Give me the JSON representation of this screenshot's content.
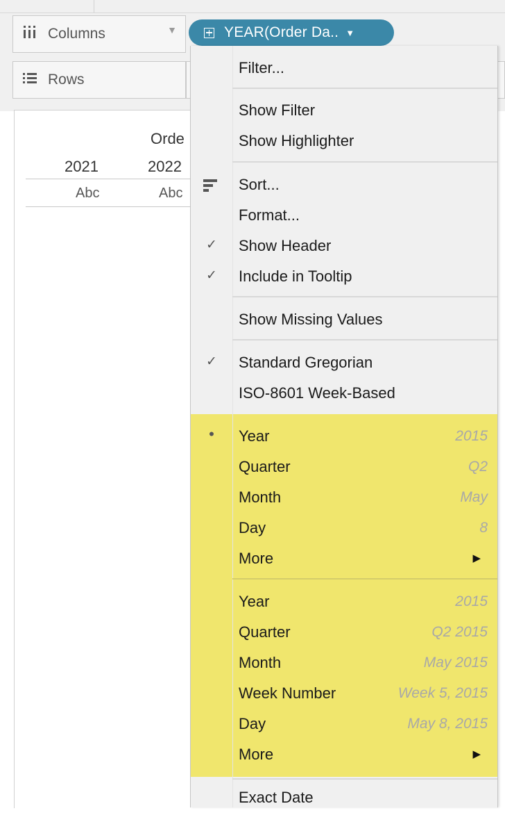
{
  "shelves": {
    "columns_label": "Columns",
    "rows_label": "Rows",
    "columns_icon": "columns-icon",
    "rows_icon": "rows-icon"
  },
  "pill": {
    "label": "YEAR(Order Da..",
    "color": "#3b88a8"
  },
  "viz": {
    "header_title": "Orde",
    "years": [
      "2021",
      "2022"
    ],
    "cells": [
      "Abc",
      "Abc"
    ]
  },
  "menu": {
    "highlight_color": "#f0e66d",
    "filter": "Filter...",
    "show_filter": "Show Filter",
    "show_highlighter": "Show Highlighter",
    "sort": "Sort...",
    "format": "Format...",
    "show_header": "Show Header",
    "include_tooltip": "Include in Tooltip",
    "show_missing": "Show Missing Values",
    "standard_gregorian": "Standard Gregorian",
    "iso_week": "ISO-8601 Week-Based",
    "discrete": [
      {
        "label": "Year",
        "value": "2015",
        "mark": "•"
      },
      {
        "label": "Quarter",
        "value": "Q2",
        "mark": ""
      },
      {
        "label": "Month",
        "value": "May",
        "mark": ""
      },
      {
        "label": "Day",
        "value": "8",
        "mark": ""
      },
      {
        "label": "More",
        "value": "",
        "mark": ""
      }
    ],
    "continuous": [
      {
        "label": "Year",
        "value": "2015"
      },
      {
        "label": "Quarter",
        "value": "Q2 2015"
      },
      {
        "label": "Month",
        "value": "May 2015"
      },
      {
        "label": "Week Number",
        "value": "Week 5, 2015"
      },
      {
        "label": "Day",
        "value": "May 8, 2015"
      },
      {
        "label": "More",
        "value": ""
      }
    ],
    "exact_date": "Exact Date"
  }
}
